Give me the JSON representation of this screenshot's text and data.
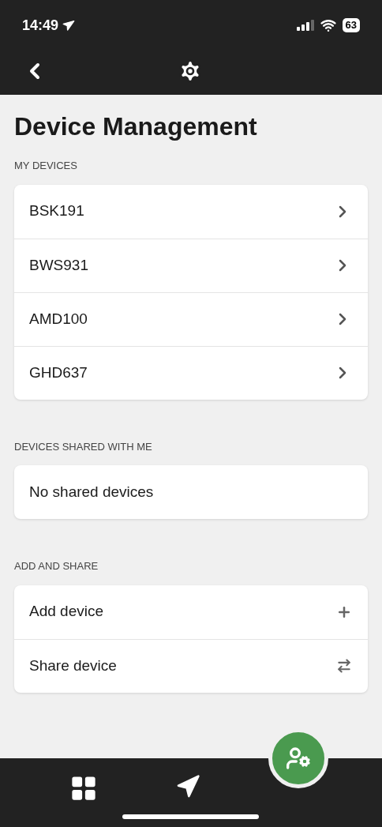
{
  "status_bar": {
    "time": "14:49",
    "battery": "63"
  },
  "title": "Device Management",
  "sections": [
    {
      "header": "MY DEVICES",
      "rows": [
        {
          "label": "BSK191",
          "kind": "chevron"
        },
        {
          "label": "BWS931",
          "kind": "chevron"
        },
        {
          "label": "AMD100",
          "kind": "chevron"
        },
        {
          "label": "GHD637",
          "kind": "chevron"
        }
      ]
    },
    {
      "header": "DEVICES SHARED WITH ME",
      "rows": [
        {
          "label": "No shared devices",
          "kind": "none"
        }
      ]
    },
    {
      "header": "ADD AND SHARE",
      "rows": [
        {
          "label": "Add device",
          "kind": "plus"
        },
        {
          "label": "Share device",
          "kind": "swap"
        }
      ]
    }
  ]
}
